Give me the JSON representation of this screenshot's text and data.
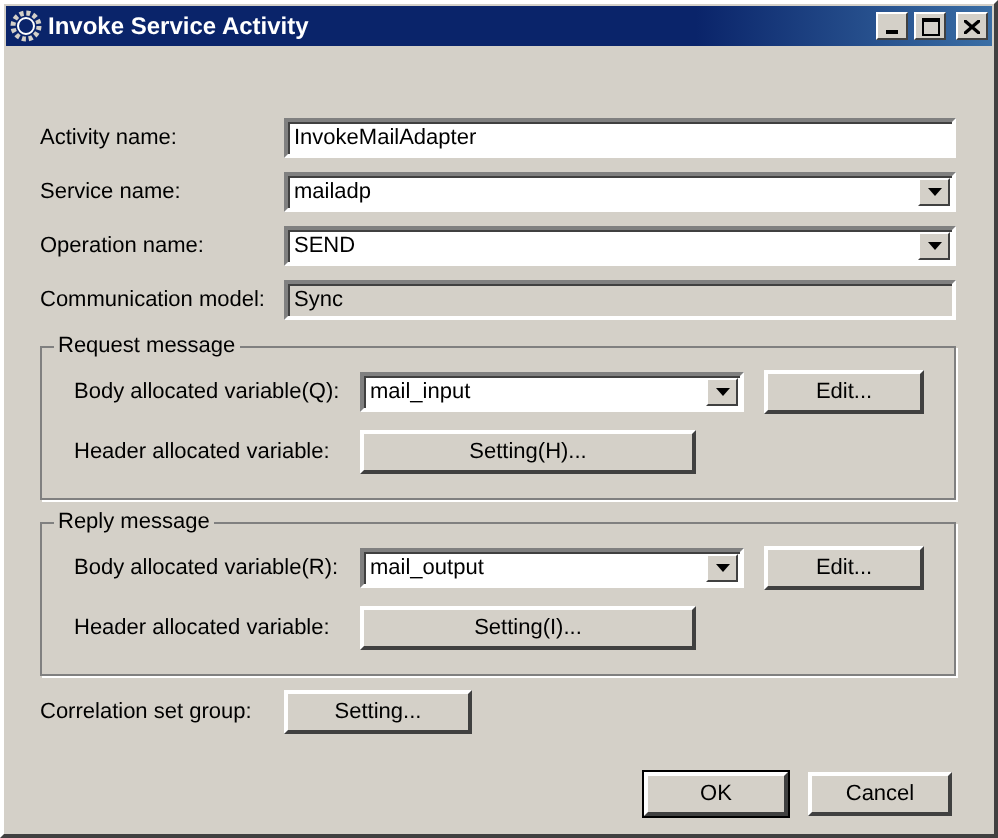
{
  "window": {
    "title": "Invoke Service Activity"
  },
  "fields": [
    {
      "label": "Activity name:",
      "value": "InvokeMailAdapter",
      "kind": "text"
    },
    {
      "label": "Service name:",
      "value": "mailadp",
      "kind": "combo"
    },
    {
      "label": "Operation name:",
      "value": "SEND",
      "kind": "combo"
    },
    {
      "label": "Communication model:",
      "value": "Sync",
      "kind": "readonly"
    }
  ],
  "groups": [
    {
      "title": "Request message",
      "body_label": "Body allocated variable(Q):",
      "body_value": "mail_input",
      "edit_button": "Edit...",
      "header_label": "Header allocated variable:",
      "header_button": "Setting(H)..."
    },
    {
      "title": "Reply message",
      "body_label": "Body allocated variable(R):",
      "body_value": "mail_output",
      "edit_button": "Edit...",
      "header_label": "Header allocated variable:",
      "header_button": "Setting(I)..."
    }
  ],
  "correlation": {
    "label": "Correlation set group:",
    "button": "Setting..."
  },
  "buttons": [
    {
      "label": "OK",
      "default": true
    },
    {
      "label": "Cancel",
      "default": false
    }
  ]
}
